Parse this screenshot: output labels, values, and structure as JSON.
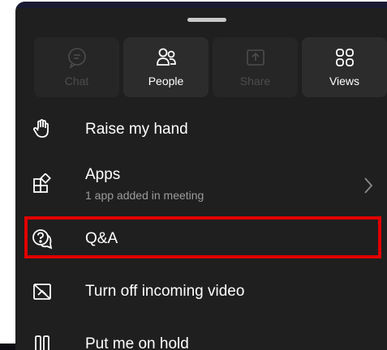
{
  "tiles": [
    {
      "label": "Chat",
      "icon": "chat-icon",
      "enabled": false
    },
    {
      "label": "People",
      "icon": "people-icon",
      "enabled": true
    },
    {
      "label": "Share",
      "icon": "share-icon",
      "enabled": false
    },
    {
      "label": "Views",
      "icon": "views-icon",
      "enabled": true
    }
  ],
  "menu": {
    "raise_hand": {
      "label": "Raise my hand",
      "icon": "hand-icon"
    },
    "apps": {
      "label": "Apps",
      "sublabel": "1 app added in meeting",
      "icon": "apps-icon"
    },
    "qa": {
      "label": "Q&A",
      "icon": "qa-icon"
    },
    "incoming_video": {
      "label": "Turn off incoming video",
      "icon": "video-off-icon"
    },
    "hold": {
      "label": "Put me on hold",
      "icon": "hold-icon"
    }
  },
  "colors": {
    "sheet": "#1f1f1f",
    "tile": "#2c2c2c",
    "tile_disabled": "#262626",
    "highlight": "#e00000",
    "text": "#ffffff",
    "subtext": "#9c9c9c"
  }
}
